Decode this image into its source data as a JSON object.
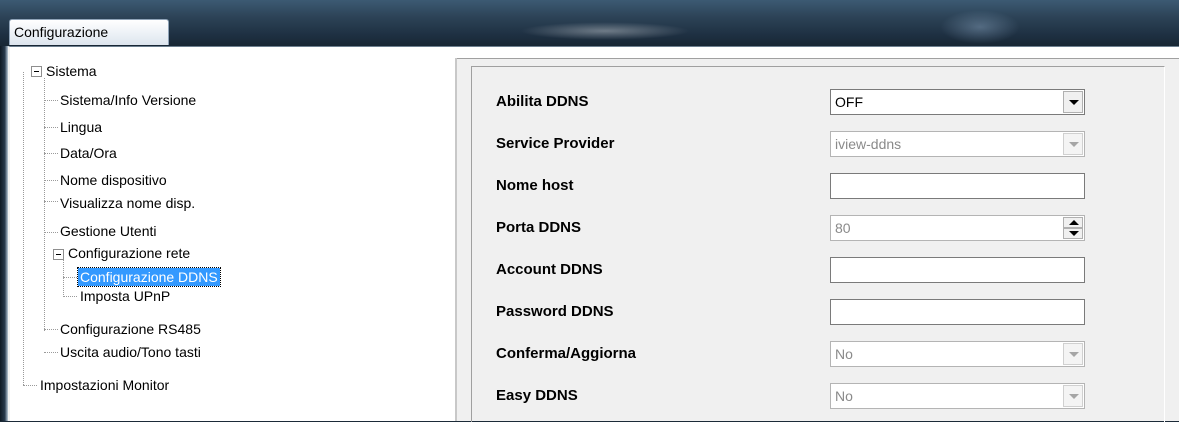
{
  "window": {
    "title": "Configurazione"
  },
  "tree": {
    "root": {
      "label": "Sistema",
      "expanded": true
    },
    "items": [
      {
        "label": "Sistema/Info Versione"
      },
      {
        "label": "Lingua"
      },
      {
        "label": "Data/Ora"
      },
      {
        "label": "Nome dispositivo"
      },
      {
        "label": "Visualizza nome disp."
      },
      {
        "label": "Gestione Utenti"
      },
      {
        "label": "Configurazione rete",
        "expanded": true
      },
      {
        "label": "Configurazione DDNS",
        "selected": true
      },
      {
        "label": "Imposta UPnP"
      },
      {
        "label": "Configurazione RS485"
      },
      {
        "label": "Uscita audio/Tono tasti"
      }
    ],
    "root2": {
      "label": "Impostazioni Monitor"
    }
  },
  "ddns_form": {
    "abilita": {
      "label": "Abilita DDNS",
      "value": "OFF",
      "control": "combo",
      "enabled": true
    },
    "provider": {
      "label": "Service Provider",
      "value": "iview-ddns",
      "control": "combo",
      "enabled": false
    },
    "host": {
      "label": "Nome host",
      "value": "",
      "control": "text"
    },
    "porta": {
      "label": "Porta DDNS",
      "value": "80",
      "control": "spinner",
      "enabled": false
    },
    "account": {
      "label": "Account DDNS",
      "value": "",
      "control": "text"
    },
    "password": {
      "label": "Password DDNS",
      "value": "",
      "control": "text"
    },
    "conferma": {
      "label": "Conferma/Aggiorna",
      "value": "No",
      "control": "combo",
      "enabled": false
    },
    "easy": {
      "label": "Easy DDNS",
      "value": "No",
      "control": "combo",
      "enabled": false
    }
  },
  "colors": {
    "selection": "#3399ff",
    "panel_bg": "#f0f0f0",
    "titlebar": "#1e3042"
  },
  "icons": [
    "tree-collapse-icon",
    "dropdown-arrow-icon",
    "spinner-up-icon",
    "spinner-down-icon"
  ]
}
